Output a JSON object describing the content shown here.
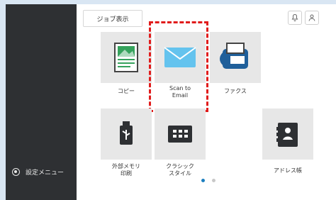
{
  "sidebar": {
    "settings_label": "設定メニュー"
  },
  "header": {
    "job_label": "ジョブ表示"
  },
  "tiles": [
    {
      "label": "コピー",
      "icon": "copy-icon"
    },
    {
      "label": "Scan to\nEmail",
      "icon": "envelope-icon"
    },
    {
      "label": "ファクス",
      "icon": "fax-icon"
    },
    {
      "label": "外部メモリ\n印刷",
      "icon": "usb-icon"
    },
    {
      "label": "クラシック\nスタイル",
      "icon": "keyboard-icon"
    },
    {
      "label": "アドレス帳",
      "icon": "address-book-icon"
    }
  ],
  "highlight_color": "#e11c1c",
  "pager": {
    "pages": 2,
    "active": 1
  }
}
